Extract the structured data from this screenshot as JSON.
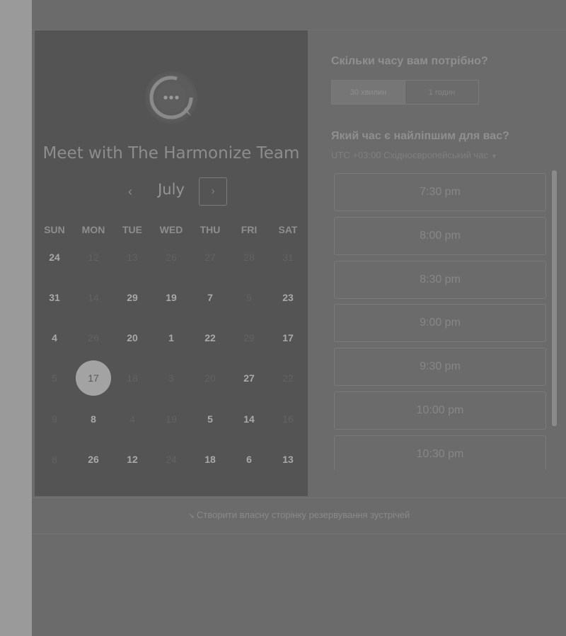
{
  "calendar": {
    "title": "Meet with The Harmonize Team",
    "month": "July",
    "prev_glyph": "‹",
    "next_glyph": "›",
    "weekdays": [
      "SUN",
      "MON",
      "TUE",
      "WED",
      "THU",
      "FRI",
      "SAT"
    ],
    "rows": [
      [
        {
          "t": "24",
          "a": true
        },
        {
          "t": "12",
          "a": false
        },
        {
          "t": "13",
          "a": false
        },
        {
          "t": "26",
          "a": false
        },
        {
          "t": "27",
          "a": false
        },
        {
          "t": "28",
          "a": false
        },
        {
          "t": "31",
          "a": false
        }
      ],
      [
        {
          "t": "31",
          "a": true
        },
        {
          "t": "14",
          "a": false
        },
        {
          "t": "29",
          "a": true
        },
        {
          "t": "19",
          "a": true
        },
        {
          "t": "7",
          "a": true
        },
        {
          "t": "9",
          "a": false
        },
        {
          "t": "23",
          "a": true
        }
      ],
      [
        {
          "t": "4",
          "a": true
        },
        {
          "t": "26",
          "a": false
        },
        {
          "t": "20",
          "a": true
        },
        {
          "t": "1",
          "a": true
        },
        {
          "t": "22",
          "a": true
        },
        {
          "t": "29",
          "a": false
        },
        {
          "t": "17",
          "a": true
        }
      ],
      [
        {
          "t": "5",
          "a": false
        },
        {
          "t": "17",
          "a": true,
          "selected": true
        },
        {
          "t": "18",
          "a": false
        },
        {
          "t": "3",
          "a": false
        },
        {
          "t": "20",
          "a": false
        },
        {
          "t": "27",
          "a": true
        },
        {
          "t": "22",
          "a": false
        }
      ],
      [
        {
          "t": "9",
          "a": false
        },
        {
          "t": "8",
          "a": true
        },
        {
          "t": "4",
          "a": false
        },
        {
          "t": "19",
          "a": false
        },
        {
          "t": "5",
          "a": true
        },
        {
          "t": "14",
          "a": true
        },
        {
          "t": "16",
          "a": false
        }
      ],
      [
        {
          "t": "8",
          "a": false
        },
        {
          "t": "26",
          "a": true
        },
        {
          "t": "12",
          "a": true
        },
        {
          "t": "24",
          "a": false
        },
        {
          "t": "18",
          "a": true
        },
        {
          "t": "6",
          "a": true
        },
        {
          "t": "13",
          "a": true
        }
      ]
    ]
  },
  "booking": {
    "duration_question": "Скільки часу вам потрібно?",
    "durations": [
      "30 хвилин",
      "1 годин"
    ],
    "selected_duration": 0,
    "time_question": "Який час є найліпшим для вас?",
    "timezone": "UTC +03:00 Східноєвропейський час",
    "slots": [
      "7:30 pm",
      "8:00 pm",
      "8:30 pm",
      "9:00 pm",
      "9:30 pm",
      "10:00 pm",
      "10:30 pm"
    ]
  },
  "footer": {
    "link": "Створити власну сторінку резервування зустрічей",
    "icon": "link-icon"
  }
}
